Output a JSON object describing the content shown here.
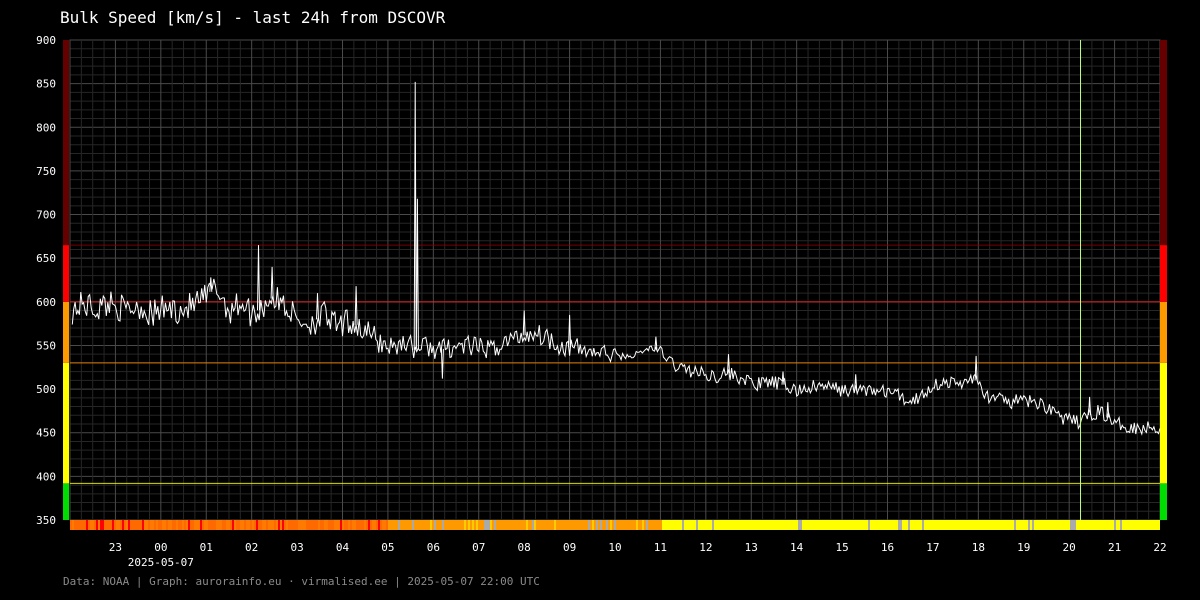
{
  "chart_data": {
    "type": "line",
    "title": "Bulk Speed [km/s] - last 24h from DSCOVR",
    "ylabel": "",
    "xlabel": "",
    "ylim": [
      350,
      900
    ],
    "yticks": [
      350,
      400,
      450,
      500,
      550,
      600,
      650,
      700,
      750,
      800,
      850,
      900
    ],
    "xticks": [
      "23",
      "00",
      "01",
      "02",
      "03",
      "04",
      "05",
      "06",
      "07",
      "08",
      "09",
      "10",
      "11",
      "12",
      "13",
      "14",
      "15",
      "16",
      "17",
      "18",
      "19",
      "20",
      "21",
      "22"
    ],
    "xtick_hours": [
      23,
      24,
      25,
      26,
      27,
      28,
      29,
      30,
      31,
      32,
      33,
      34,
      35,
      36,
      37,
      38,
      39,
      40,
      41,
      42,
      43,
      44,
      45,
      46
    ],
    "xrange_hours": [
      22,
      46
    ],
    "date_label": "2025-05-07",
    "grid": true,
    "thresholds": [
      {
        "value": 392,
        "color": "#ffff00"
      },
      {
        "value": 530,
        "color": "#ff8c00"
      },
      {
        "value": 600,
        "color": "#ff2020"
      },
      {
        "value": 665,
        "color": "#8b0000"
      }
    ],
    "level_bands": [
      {
        "from": 350,
        "to": 392,
        "color": "#00dd00"
      },
      {
        "from": 392,
        "to": 530,
        "color": "#ffff00"
      },
      {
        "from": 530,
        "to": 600,
        "color": "#ff9900"
      },
      {
        "from": 600,
        "to": 665,
        "color": "#ff0000"
      },
      {
        "from": 665,
        "to": 900,
        "color": "#660000"
      }
    ],
    "now_marker_hour": 44.25,
    "series": [
      {
        "color": "#ffffff",
        "points": [
          [
            22.05,
            590
          ],
          [
            22.3,
            598
          ],
          [
            22.6,
            592
          ],
          [
            22.9,
            600
          ],
          [
            23.2,
            590
          ],
          [
            23.5,
            596
          ],
          [
            23.8,
            585
          ],
          [
            24.1,
            593
          ],
          [
            24.4,
            590
          ],
          [
            24.7,
            596
          ],
          [
            25.0,
            605
          ],
          [
            25.2,
            618
          ],
          [
            25.5,
            590
          ],
          [
            25.8,
            600
          ],
          [
            26.0,
            585
          ],
          [
            26.2,
            592
          ],
          [
            26.4,
            605
          ],
          [
            26.7,
            598
          ],
          [
            27.0,
            580
          ],
          [
            27.3,
            575
          ],
          [
            27.6,
            585
          ],
          [
            27.9,
            570
          ],
          [
            28.2,
            578
          ],
          [
            28.5,
            565
          ],
          [
            28.8,
            555
          ],
          [
            29.1,
            548
          ],
          [
            29.4,
            555
          ],
          [
            29.6,
            545
          ],
          [
            29.8,
            550
          ],
          [
            30.1,
            545
          ],
          [
            30.4,
            548
          ],
          [
            30.7,
            550
          ],
          [
            31.0,
            547
          ],
          [
            31.3,
            545
          ],
          [
            31.6,
            555
          ],
          [
            31.9,
            560
          ],
          [
            32.2,
            565
          ],
          [
            32.5,
            560
          ],
          [
            32.8,
            550
          ],
          [
            33.0,
            548
          ],
          [
            33.3,
            545
          ],
          [
            33.6,
            542
          ],
          [
            33.9,
            540
          ],
          [
            34.2,
            537
          ],
          [
            34.5,
            540
          ],
          [
            34.8,
            548
          ],
          [
            35.0,
            542
          ],
          [
            35.3,
            528
          ],
          [
            35.6,
            522
          ],
          [
            35.9,
            518
          ],
          [
            36.2,
            515
          ],
          [
            36.5,
            518
          ],
          [
            36.8,
            512
          ],
          [
            37.1,
            505
          ],
          [
            37.4,
            508
          ],
          [
            37.7,
            505
          ],
          [
            38.0,
            498
          ],
          [
            38.3,
            502
          ],
          [
            38.6,
            503
          ],
          [
            38.9,
            500
          ],
          [
            39.2,
            498
          ],
          [
            39.5,
            500
          ],
          [
            39.8,
            497
          ],
          [
            40.1,
            497
          ],
          [
            40.4,
            487
          ],
          [
            40.7,
            490
          ],
          [
            41.0,
            505
          ],
          [
            41.3,
            508
          ],
          [
            41.6,
            505
          ],
          [
            41.9,
            515
          ],
          [
            42.1,
            495
          ],
          [
            42.4,
            488
          ],
          [
            42.7,
            485
          ],
          [
            43.0,
            487
          ],
          [
            43.3,
            484
          ],
          [
            43.6,
            478
          ],
          [
            43.9,
            465
          ],
          [
            44.2,
            462
          ],
          [
            44.5,
            472
          ],
          [
            44.7,
            475
          ],
          [
            45.0,
            460
          ],
          [
            45.3,
            458
          ],
          [
            45.6,
            455
          ],
          [
            45.9,
            457
          ],
          [
            46.0,
            455
          ]
        ],
        "spikes": [
          [
            25.1,
            628
          ],
          [
            26.15,
            665
          ],
          [
            26.45,
            640
          ],
          [
            27.45,
            610
          ],
          [
            28.3,
            618
          ],
          [
            29.6,
            852
          ],
          [
            29.65,
            718
          ],
          [
            30.2,
            512
          ],
          [
            32.0,
            590
          ],
          [
            33.0,
            585
          ],
          [
            34.9,
            560
          ],
          [
            36.5,
            540
          ],
          [
            37.7,
            520
          ],
          [
            39.3,
            517
          ],
          [
            41.95,
            538
          ],
          [
            44.45,
            491
          ],
          [
            44.85,
            485
          ]
        ]
      }
    ],
    "strip_colors": [
      "#ff7a00",
      "#ff8c00",
      "#ff6a00",
      "#ff0000",
      "#ff9900",
      "#ffcc00",
      "#aaaaaa",
      "#ffff00"
    ]
  },
  "footer": "Data: NOAA | Graph: aurorainfo.eu · virmalised.ee | 2025-05-07 22:00 UTC"
}
